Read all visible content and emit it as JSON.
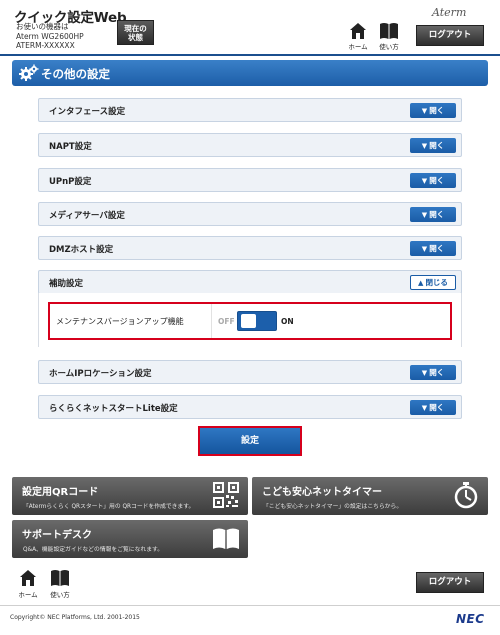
{
  "header": {
    "app_title": "クイック設定Web",
    "device_caption": "お使いの機器は",
    "device_model": "Aterm WG2600HP",
    "device_name": "ATERM-XXXXXX",
    "status_button_line1": "現在の",
    "status_button_line2": "状態",
    "home_label": "ホーム",
    "manual_label": "使い方",
    "logout_label": "ログアウト",
    "brand": "Aterm"
  },
  "section": {
    "title": "その他の設定"
  },
  "accordion": {
    "open_label": "開く",
    "close_label": "閉じる",
    "items": [
      {
        "label": "インタフェース設定",
        "state": "collapsed"
      },
      {
        "label": "NAPT設定",
        "state": "collapsed"
      },
      {
        "label": "UPnP設定",
        "state": "collapsed"
      },
      {
        "label": "メディアサーバ設定",
        "state": "collapsed"
      },
      {
        "label": "DMZホスト設定",
        "state": "collapsed"
      },
      {
        "label": "補助設定",
        "state": "expanded"
      },
      {
        "label": "ホームIPロケーション設定",
        "state": "collapsed"
      },
      {
        "label": "らくらくネットスタートLite設定",
        "state": "collapsed"
      }
    ]
  },
  "maintenance": {
    "label": "メンテナンスバージョンアップ機能",
    "off_label": "OFF",
    "on_label": "ON",
    "value": "ON"
  },
  "submit_label": "設定",
  "tiles": {
    "qr": {
      "title": "設定用QRコード",
      "desc": "「Atermらくらく QRスタート」用の QRコードを作成できます。",
      "icon": "qr-code-icon"
    },
    "timer": {
      "title": "こども安心ネットタイマー",
      "desc": "「こども安心ネットタイマー」の設定はこちらから。",
      "icon": "stopwatch-icon"
    },
    "support": {
      "title": "サポートデスク",
      "desc": "Q&A、機能設定ガイドなどの情報をご覧になれます。",
      "icon": "book-icon"
    }
  },
  "footer": {
    "home_label": "ホーム",
    "manual_label": "使い方",
    "logout_label": "ログアウト",
    "copyright": "Copyright© NEC Platforms, Ltd. 2001-2015",
    "logo": "NEC"
  },
  "colors": {
    "accent_blue": "#1d5ea8",
    "highlight_red": "#d6001c",
    "tile_gray": "#4a4a4a"
  }
}
